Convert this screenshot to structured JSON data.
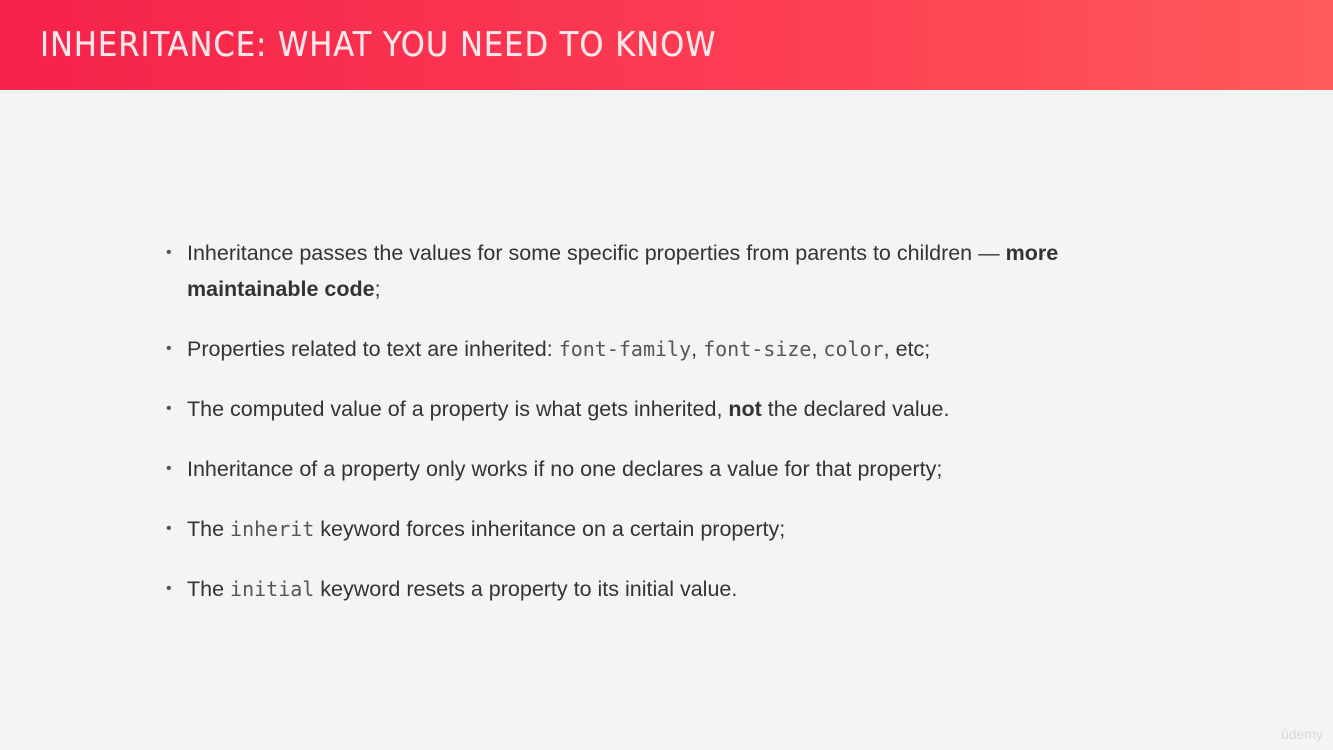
{
  "header": {
    "title": "INHERITANCE: WHAT YOU NEED TO KNOW"
  },
  "bullets": [
    {
      "t1": "Inheritance passes the values for some specific properties from parents to children — ",
      "bold1": "more maintainable code",
      "t2": ";"
    },
    {
      "t1": "Properties related to text are inherited: ",
      "code1": "font-family",
      "t2": ", ",
      "code2": "font-size",
      "t3": ", ",
      "code3": "color",
      "t4": ", etc;"
    },
    {
      "t1": "The computed value of a property is what gets inherited, ",
      "bold1": "not",
      "t2": " the declared value."
    },
    {
      "t1": "Inheritance of a property only works if no one declares a value for that property;"
    },
    {
      "t1": "The ",
      "code1": "inherit",
      "t2": " keyword forces inheritance on a certain property;"
    },
    {
      "t1": "The ",
      "code1": "initial",
      "t2": " keyword resets a property to its initial value."
    }
  ],
  "bullet_marker": "•",
  "watermark": "ûdemy"
}
